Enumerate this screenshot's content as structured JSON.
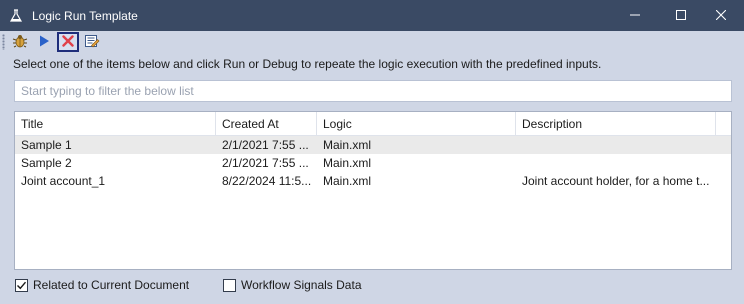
{
  "window": {
    "title": "Logic Run Template",
    "icon": "flask-icon",
    "controls": {
      "minimize": "minimize-icon",
      "maximize": "maximize-icon",
      "close": "close-icon"
    }
  },
  "toolbar": {
    "buttons": [
      {
        "name": "debug",
        "icon": "bug-icon"
      },
      {
        "name": "run",
        "icon": "play-icon"
      },
      {
        "name": "delete",
        "icon": "delete-x-icon",
        "focused": true
      },
      {
        "name": "edit",
        "icon": "edit-list-icon"
      }
    ]
  },
  "instructions": "Select one of the items below and click Run or Debug to repeate the logic execution with the predefined inputs.",
  "filter": {
    "value": "",
    "placeholder": "Start typing to filter the below list"
  },
  "table": {
    "columns": [
      "Title",
      "Created At",
      "Logic",
      "Description"
    ],
    "rows": [
      {
        "title": "Sample 1",
        "created": "2/1/2021 7:55 ...",
        "logic": "Main.xml",
        "description": ""
      },
      {
        "title": "Sample 2",
        "created": "2/1/2021 7:55 ...",
        "logic": "Main.xml",
        "description": ""
      },
      {
        "title": "Joint account_1",
        "created": "8/22/2024 11:5...",
        "logic": "Main.xml",
        "description": "Joint account holder, for a home t..."
      }
    ]
  },
  "options": {
    "related": {
      "label": "Related to Current Document",
      "checked": true
    },
    "workflow": {
      "label": "Workflow Signals Data",
      "checked": false
    }
  },
  "colors": {
    "titlebar": "#3a4a64",
    "body": "#cfd6e5",
    "accent": "#2a62c9",
    "delete": "#e0404a"
  }
}
